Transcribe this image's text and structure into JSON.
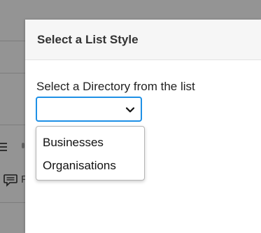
{
  "modal": {
    "title": "Select a List Style",
    "field_label": "Select a Directory from the list",
    "select": {
      "selected_value": "",
      "options": [
        "Businesses",
        "Organisations"
      ]
    }
  },
  "background": {
    "letter_hint": "F"
  },
  "icons": {
    "select_chevron": "chevron-down-icon",
    "menu": "menu-icon",
    "chat": "chat-icon"
  },
  "colors": {
    "focus_border": "#1e90e6",
    "overlay": "rgba(0,0,0,0.42)"
  }
}
